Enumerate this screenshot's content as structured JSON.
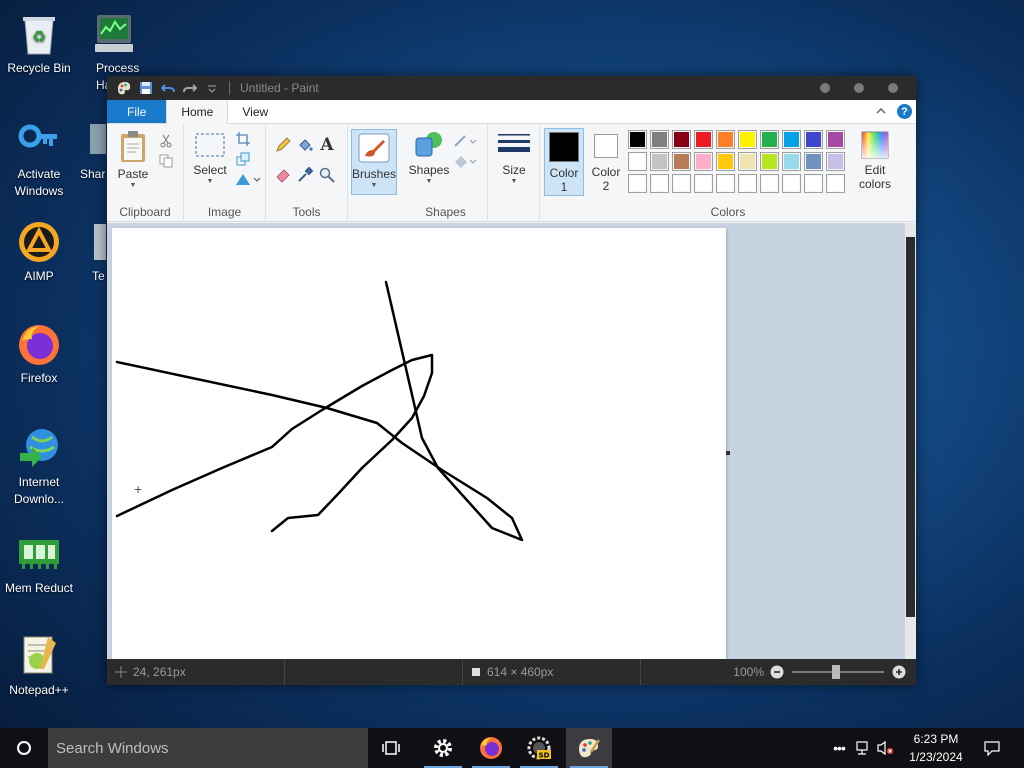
{
  "desktop": {
    "icons": [
      {
        "name": "recycle-bin",
        "label": "Recycle Bin"
      },
      {
        "name": "process-hacker",
        "label": "Process Ha"
      },
      {
        "name": "activate-windows",
        "label": "Activate Windows"
      },
      {
        "name": "share",
        "label": "Shar"
      },
      {
        "name": "aimp",
        "label": "AIMP"
      },
      {
        "name": "te",
        "label": "Te"
      },
      {
        "name": "firefox",
        "label": "Firefox"
      },
      {
        "name": "internet-download",
        "label": "Internet Downlo..."
      },
      {
        "name": "mem-reduct",
        "label": "Mem Reduct"
      },
      {
        "name": "notepad-plus-plus",
        "label": "Notepad++"
      }
    ]
  },
  "window": {
    "title": "Untitled - Paint",
    "tabs": {
      "file": "File",
      "home": "Home",
      "view": "View"
    },
    "help_label": "?"
  },
  "ribbon": {
    "clipboard": {
      "label": "Clipboard",
      "paste": "Paste"
    },
    "image": {
      "label": "Image",
      "select": "Select"
    },
    "tools": {
      "label": "Tools"
    },
    "brushes": {
      "label": "Brushes"
    },
    "shapes": {
      "label": "Shapes",
      "shapes_btn": "Shapes"
    },
    "size": {
      "label": "Size"
    },
    "colors": {
      "label": "Colors",
      "color1": "Color",
      "color1_num": "1",
      "color2": "Color",
      "color2_num": "2",
      "edit": "Edit",
      "edit2": "colors",
      "color1_value": "#000000",
      "color2_value": "#ffffff",
      "palette_row1": [
        "#000000",
        "#7f7f7f",
        "#880015",
        "#ed1c24",
        "#ff7f27",
        "#fff200",
        "#22b14c",
        "#00a2e8",
        "#3f48cc",
        "#a349a4"
      ],
      "palette_row2": [
        "#ffffff",
        "#c3c3c3",
        "#b97a57",
        "#ffaec9",
        "#ffc90e",
        "#efe4b0",
        "#b5e61d",
        "#99d9ea",
        "#7092be",
        "#c8bfe7"
      ],
      "palette_row3": [
        "#ffffff",
        "#ffffff",
        "#ffffff",
        "#ffffff",
        "#ffffff",
        "#ffffff",
        "#ffffff",
        "#ffffff",
        "#ffffff",
        "#ffffff"
      ]
    }
  },
  "statusbar": {
    "cursor_pos": "24, 261px",
    "canvas_size": "614 × 460px",
    "zoom": "100%"
  },
  "taskbar": {
    "search_placeholder": "Search Windows",
    "time": "6:23 PM",
    "date": "1/23/2024"
  }
}
